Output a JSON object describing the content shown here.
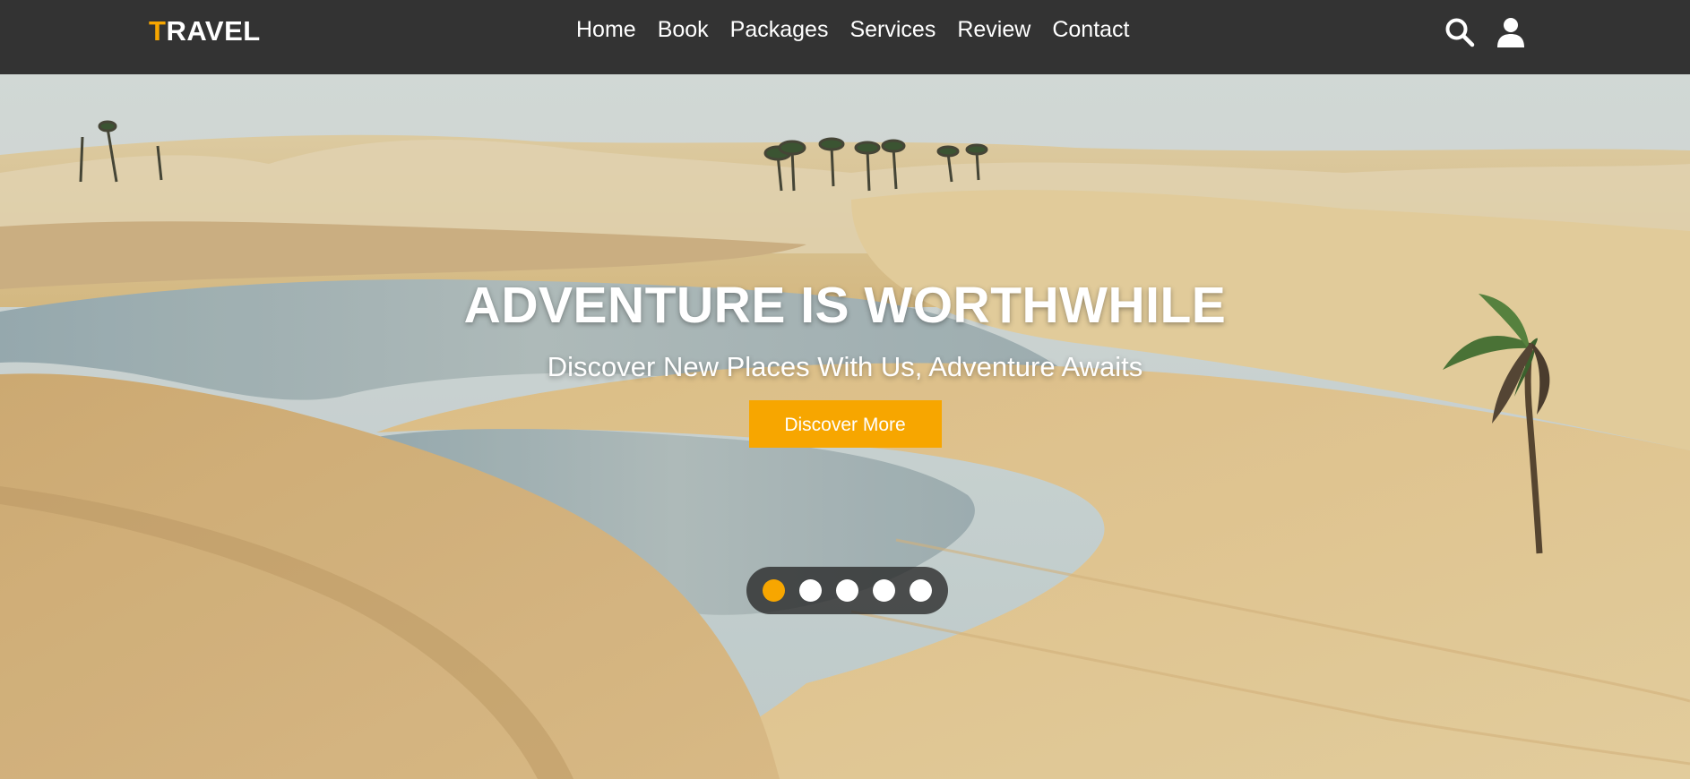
{
  "brand": {
    "first_letter": "T",
    "rest": "RAVEL",
    "accent_color": "#f7a600"
  },
  "nav": {
    "links": [
      {
        "label": "Home"
      },
      {
        "label": "Book"
      },
      {
        "label": "Packages"
      },
      {
        "label": "Services"
      },
      {
        "label": "Review"
      },
      {
        "label": "Contact"
      }
    ],
    "icons": [
      "search-icon",
      "user-icon"
    ]
  },
  "hero": {
    "title": "ADVENTURE IS WORTHWHILE",
    "subtitle": "Discover New Places With Us, Adventure Awaits",
    "cta_label": "Discover More",
    "cta_color": "#f7a600"
  },
  "slider": {
    "total_slides": 5,
    "active_index": 0
  },
  "colors": {
    "navbar_bg": "#333333",
    "text": "#ffffff"
  }
}
